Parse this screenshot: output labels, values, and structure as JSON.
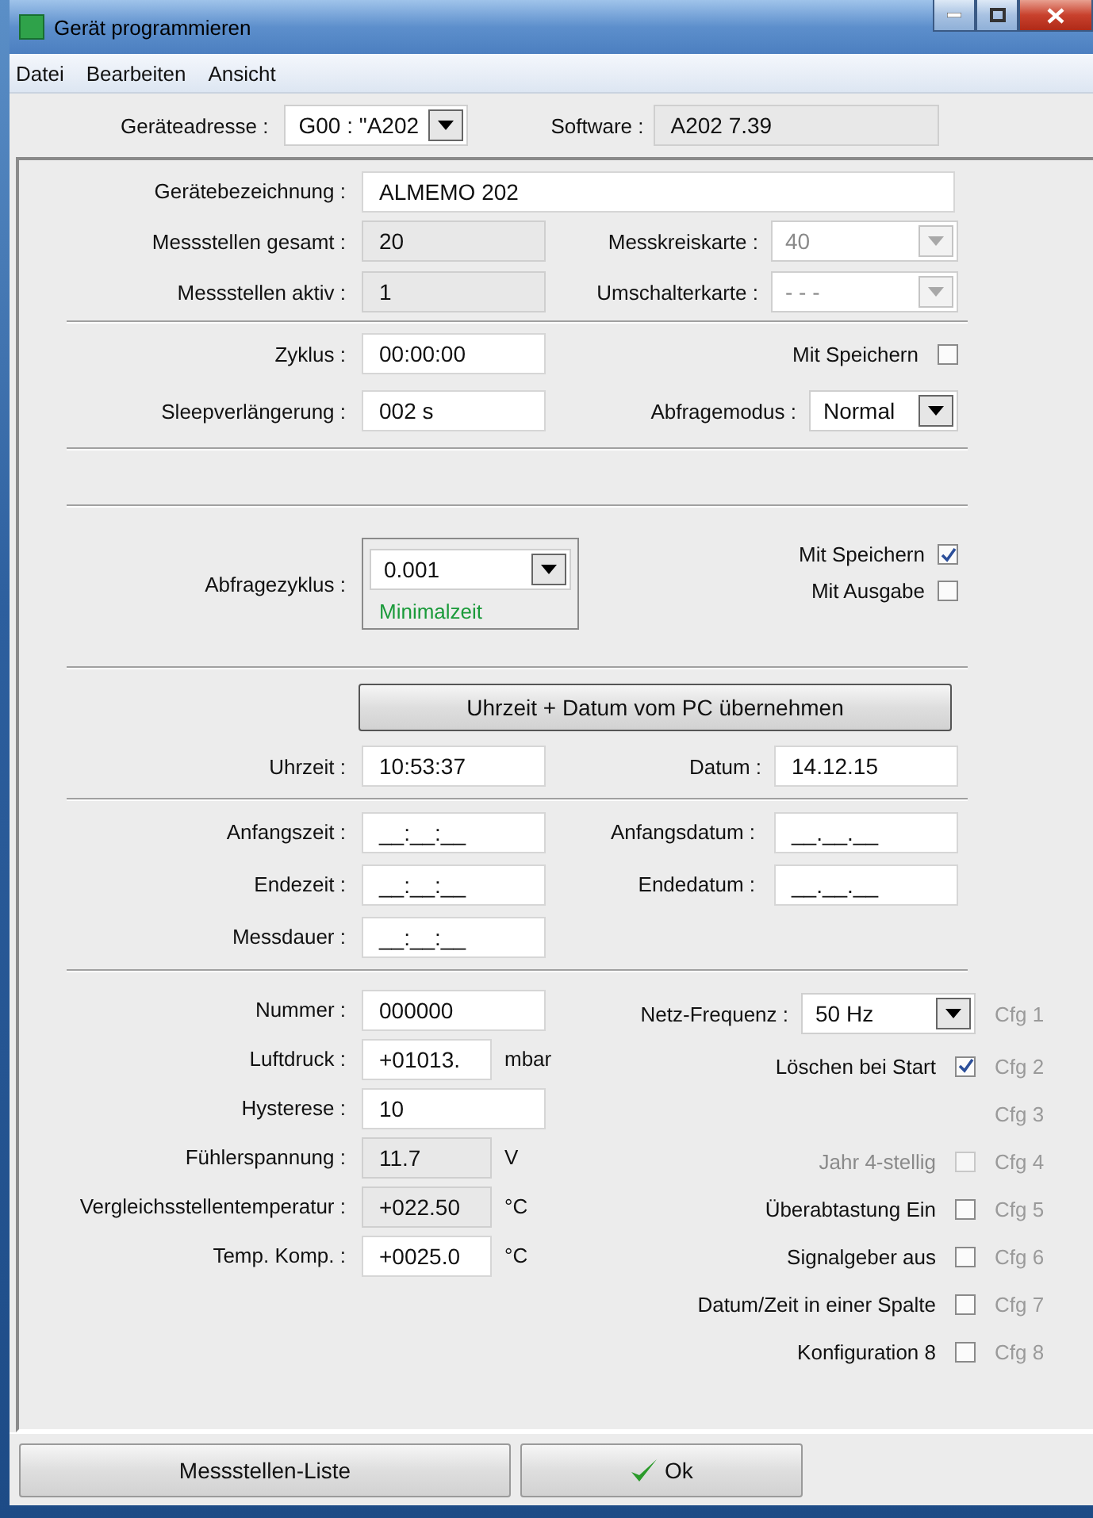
{
  "window": {
    "title": "Gerät programmieren"
  },
  "menu": [
    {
      "label": "Datei"
    },
    {
      "label": "Bearbeiten"
    },
    {
      "label": "Ansicht"
    }
  ],
  "address": {
    "label": "Geräteadresse :",
    "value": "G00 :  \"A202"
  },
  "software": {
    "label": "Software :",
    "value": "A202 7.39"
  },
  "device_name": {
    "label": "Gerätebezeichnung :",
    "value": "ALMEMO 202"
  },
  "info_rows": [
    {
      "label": "Messstellen gesamt :",
      "value": "20",
      "card_label": "Messkreiskarte :",
      "card_value": "40"
    },
    {
      "label": "Messstellen aktiv :",
      "value": "1",
      "card_label": "Umschalterkarte :",
      "card_value": "- - -"
    }
  ],
  "cycle": {
    "label": "Zyklus :",
    "value": "00:00:00",
    "save_label": "Mit Speichern",
    "save_checked": false
  },
  "sleep": {
    "label": "Sleepverlängerung :",
    "value": "002 s",
    "mode_label": "Abfragemodus :",
    "mode_value": "Normal"
  },
  "query": {
    "label": "Abfragezyklus :",
    "value": "0.001",
    "hint": "Minimalzeit",
    "options": [
      {
        "label": "Mit Speichern",
        "checked": true
      },
      {
        "label": "Mit Ausgabe",
        "checked": false
      }
    ]
  },
  "sync_button": "Uhrzeit + Datum vom PC übernehmen",
  "clock": {
    "time_label": "Uhrzeit :",
    "time": "10:53:37",
    "date_label": "Datum :",
    "date": "14.12.15"
  },
  "schedule": [
    {
      "label": "Anfangszeit :",
      "value": "__:__:__",
      "date_label": "Anfangsdatum :",
      "date_value": "__.__.__"
    },
    {
      "label": "Endezeit :",
      "value": "__:__:__",
      "date_label": "Endedatum :",
      "date_value": "__.__.__"
    },
    {
      "label": "Messdauer :",
      "value": "__:__:__"
    }
  ],
  "params": [
    {
      "label": "Nummer :",
      "value": "000000",
      "readonly": false
    },
    {
      "label": "Luftdruck :",
      "value": "+01013.",
      "unit": "mbar",
      "readonly": false
    },
    {
      "label": "Hysterese :",
      "value": "10",
      "readonly": false
    },
    {
      "label": "Fühlerspannung :",
      "value": "11.7",
      "unit": "V",
      "readonly": true
    },
    {
      "label": "Vergleichsstellentemperatur :",
      "value": "+022.50",
      "unit": "°C",
      "readonly": true
    },
    {
      "label": "Temp. Komp. :",
      "value": "+0025.0",
      "unit": "°C",
      "readonly": false
    }
  ],
  "config": [
    {
      "kind": "select",
      "label": "Netz-Frequenz :",
      "value": "50 Hz",
      "tag": "Cfg 1"
    },
    {
      "kind": "check",
      "label": "Löschen bei Start",
      "checked": true,
      "disabled": false,
      "tag": "Cfg 2"
    },
    {
      "kind": "empty",
      "tag": "Cfg 3"
    },
    {
      "kind": "check",
      "label": "Jahr 4-stellig",
      "checked": false,
      "disabled": true,
      "tag": "Cfg 4"
    },
    {
      "kind": "check",
      "label": "Überabtastung Ein",
      "checked": false,
      "disabled": false,
      "tag": "Cfg 5"
    },
    {
      "kind": "check",
      "label": "Signalgeber aus",
      "checked": false,
      "disabled": false,
      "tag": "Cfg 6"
    },
    {
      "kind": "check",
      "label": "Datum/Zeit in einer Spalte",
      "checked": false,
      "disabled": false,
      "tag": "Cfg 7"
    },
    {
      "kind": "check",
      "label": "Konfiguration 8",
      "checked": false,
      "disabled": false,
      "tag": "Cfg 8"
    }
  ],
  "buttons": [
    {
      "kind": "list",
      "label": "Messstellen-Liste"
    },
    {
      "kind": "ok",
      "label": "Ok"
    }
  ]
}
